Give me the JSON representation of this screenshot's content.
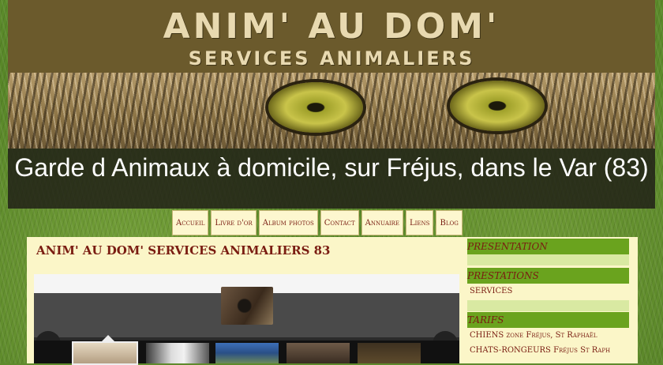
{
  "banner": {
    "title": "ANIM' AU DOM'",
    "subtitle": "SERVICES ANIMALIERS"
  },
  "tagline": "Garde d Animaux à domicile, sur Fréjus, dans le Var (83)",
  "nav": [
    {
      "label": "Accueil"
    },
    {
      "label": "Livre d'or"
    },
    {
      "label": "Album photos"
    },
    {
      "label": "Contact"
    },
    {
      "label": "Annuaire"
    },
    {
      "label": "Liens"
    },
    {
      "label": "Blog"
    }
  ],
  "main": {
    "title": "ANIM' AU DOM' SERVICES ANIMALIERS 83"
  },
  "gallery": {
    "prev_icon": "rewind-icon",
    "next_icon": "fast-forward-icon",
    "prev_glyph": "◀◀",
    "next_glyph": "▶▶"
  },
  "sidebar": {
    "presentation": "PRESENTATION",
    "prestations": "PRESTATIONS",
    "services": "SERVICES",
    "tarifs": "TARIFS",
    "chiens": "CHIENS zone Fréjus, St Raphaël",
    "chats": "CHATS-RONGEURS Fréjus St Raph"
  },
  "colors": {
    "accent": "#7a1d12",
    "panel": "#fbf6c8",
    "side_head": "#6aa31e"
  }
}
